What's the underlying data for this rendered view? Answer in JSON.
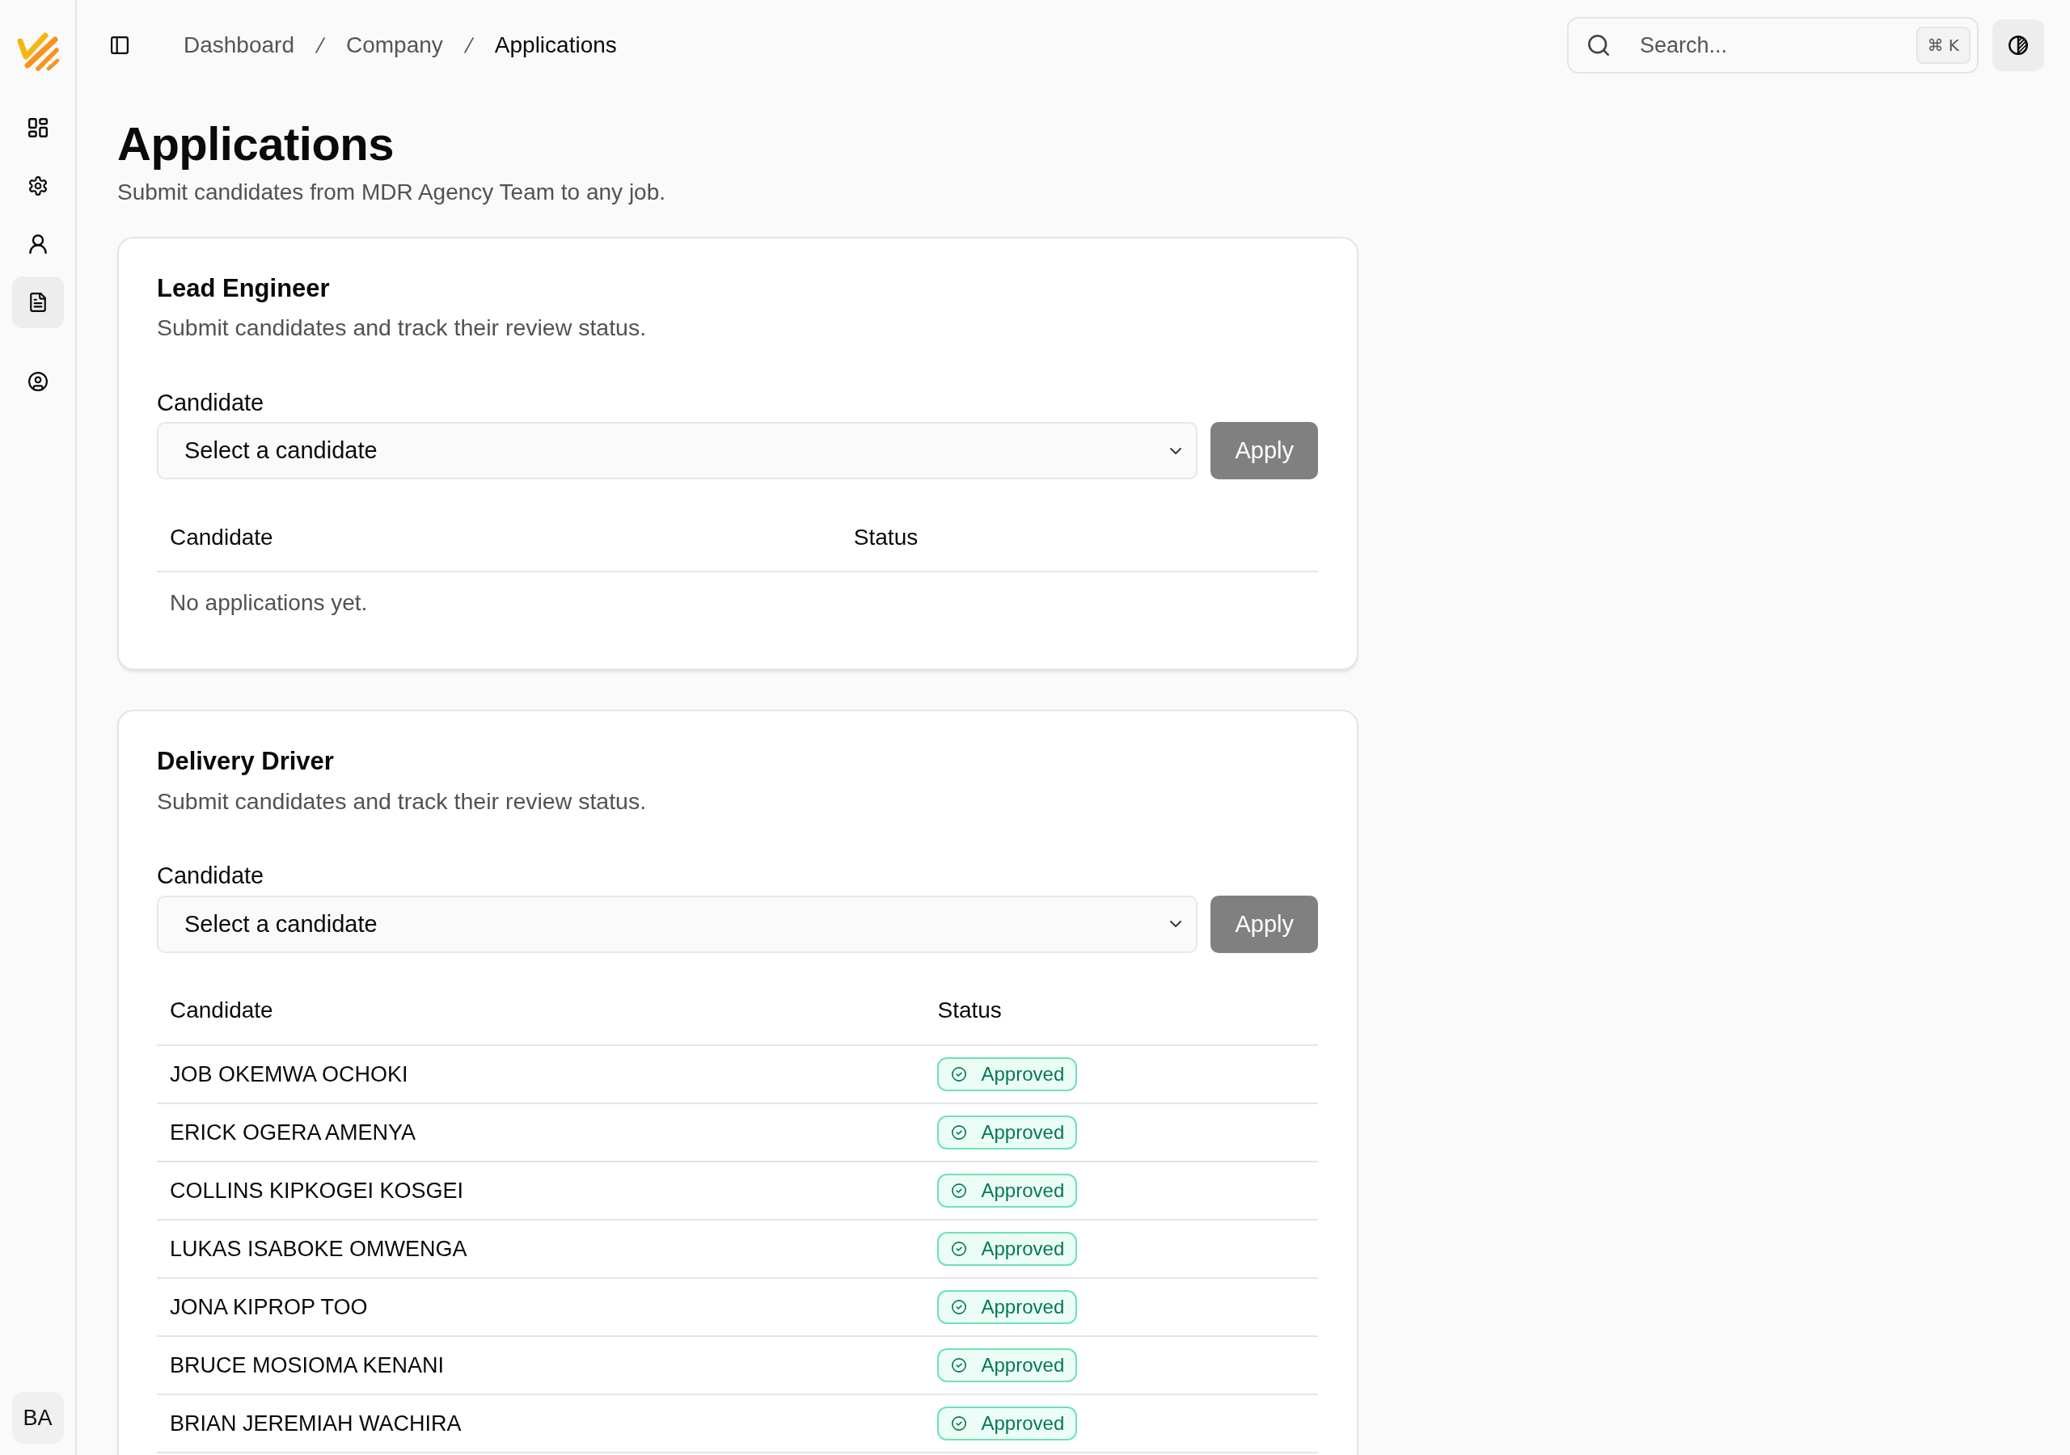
{
  "sidebar": {
    "nav_items": [
      {
        "selected": false
      },
      {
        "selected": false
      },
      {
        "selected": false
      },
      {
        "selected": true
      }
    ],
    "secondary_items": [
      {
        "selected": false
      }
    ],
    "user_initials": "BA"
  },
  "topbar": {
    "breadcrumb": [
      {
        "label": "Dashboard",
        "current": false
      },
      {
        "label": "Company",
        "current": false
      },
      {
        "label": "Applications",
        "current": true
      }
    ],
    "search": {
      "placeholder": "Search...",
      "shortcut": "⌘ K"
    }
  },
  "page": {
    "title": "Applications",
    "subtitle": "Submit candidates from MDR Agency Team to any job."
  },
  "jobs": [
    {
      "title": "Lead Engineer",
      "subtitle": "Submit candidates and track their review status.",
      "field_label": "Candidate",
      "select": {
        "placeholder": "Select a candidate"
      },
      "apply_button": {
        "label": "Apply",
        "disabled": true
      },
      "columns": [
        "Candidate",
        "Status"
      ],
      "empty_text": "No applications yet."
    },
    {
      "title": "Delivery Driver",
      "subtitle": "Submit candidates and track their review status.",
      "field_label": "Candidate",
      "select": {
        "placeholder": "Select a candidate"
      },
      "apply_button": {
        "label": "Apply",
        "disabled": true
      },
      "columns": [
        "Candidate",
        "Status"
      ],
      "rows": [
        {
          "candidate": "JOB OKEMWA OCHOKI",
          "status": "Approved"
        },
        {
          "candidate": "ERICK OGERA AMENYA",
          "status": "Approved"
        },
        {
          "candidate": "COLLINS KIPKOGEI KOSGEI",
          "status": "Approved"
        },
        {
          "candidate": "LUKAS ISABOKE OMWENGA",
          "status": "Approved"
        },
        {
          "candidate": "JONA KIPROP TOO",
          "status": "Approved"
        },
        {
          "candidate": "BRUCE MOSIOMA KENANI",
          "status": "Approved"
        },
        {
          "candidate": "BRIAN JEREMIAH WACHIRA",
          "status": "Approved"
        }
      ]
    }
  ]
}
